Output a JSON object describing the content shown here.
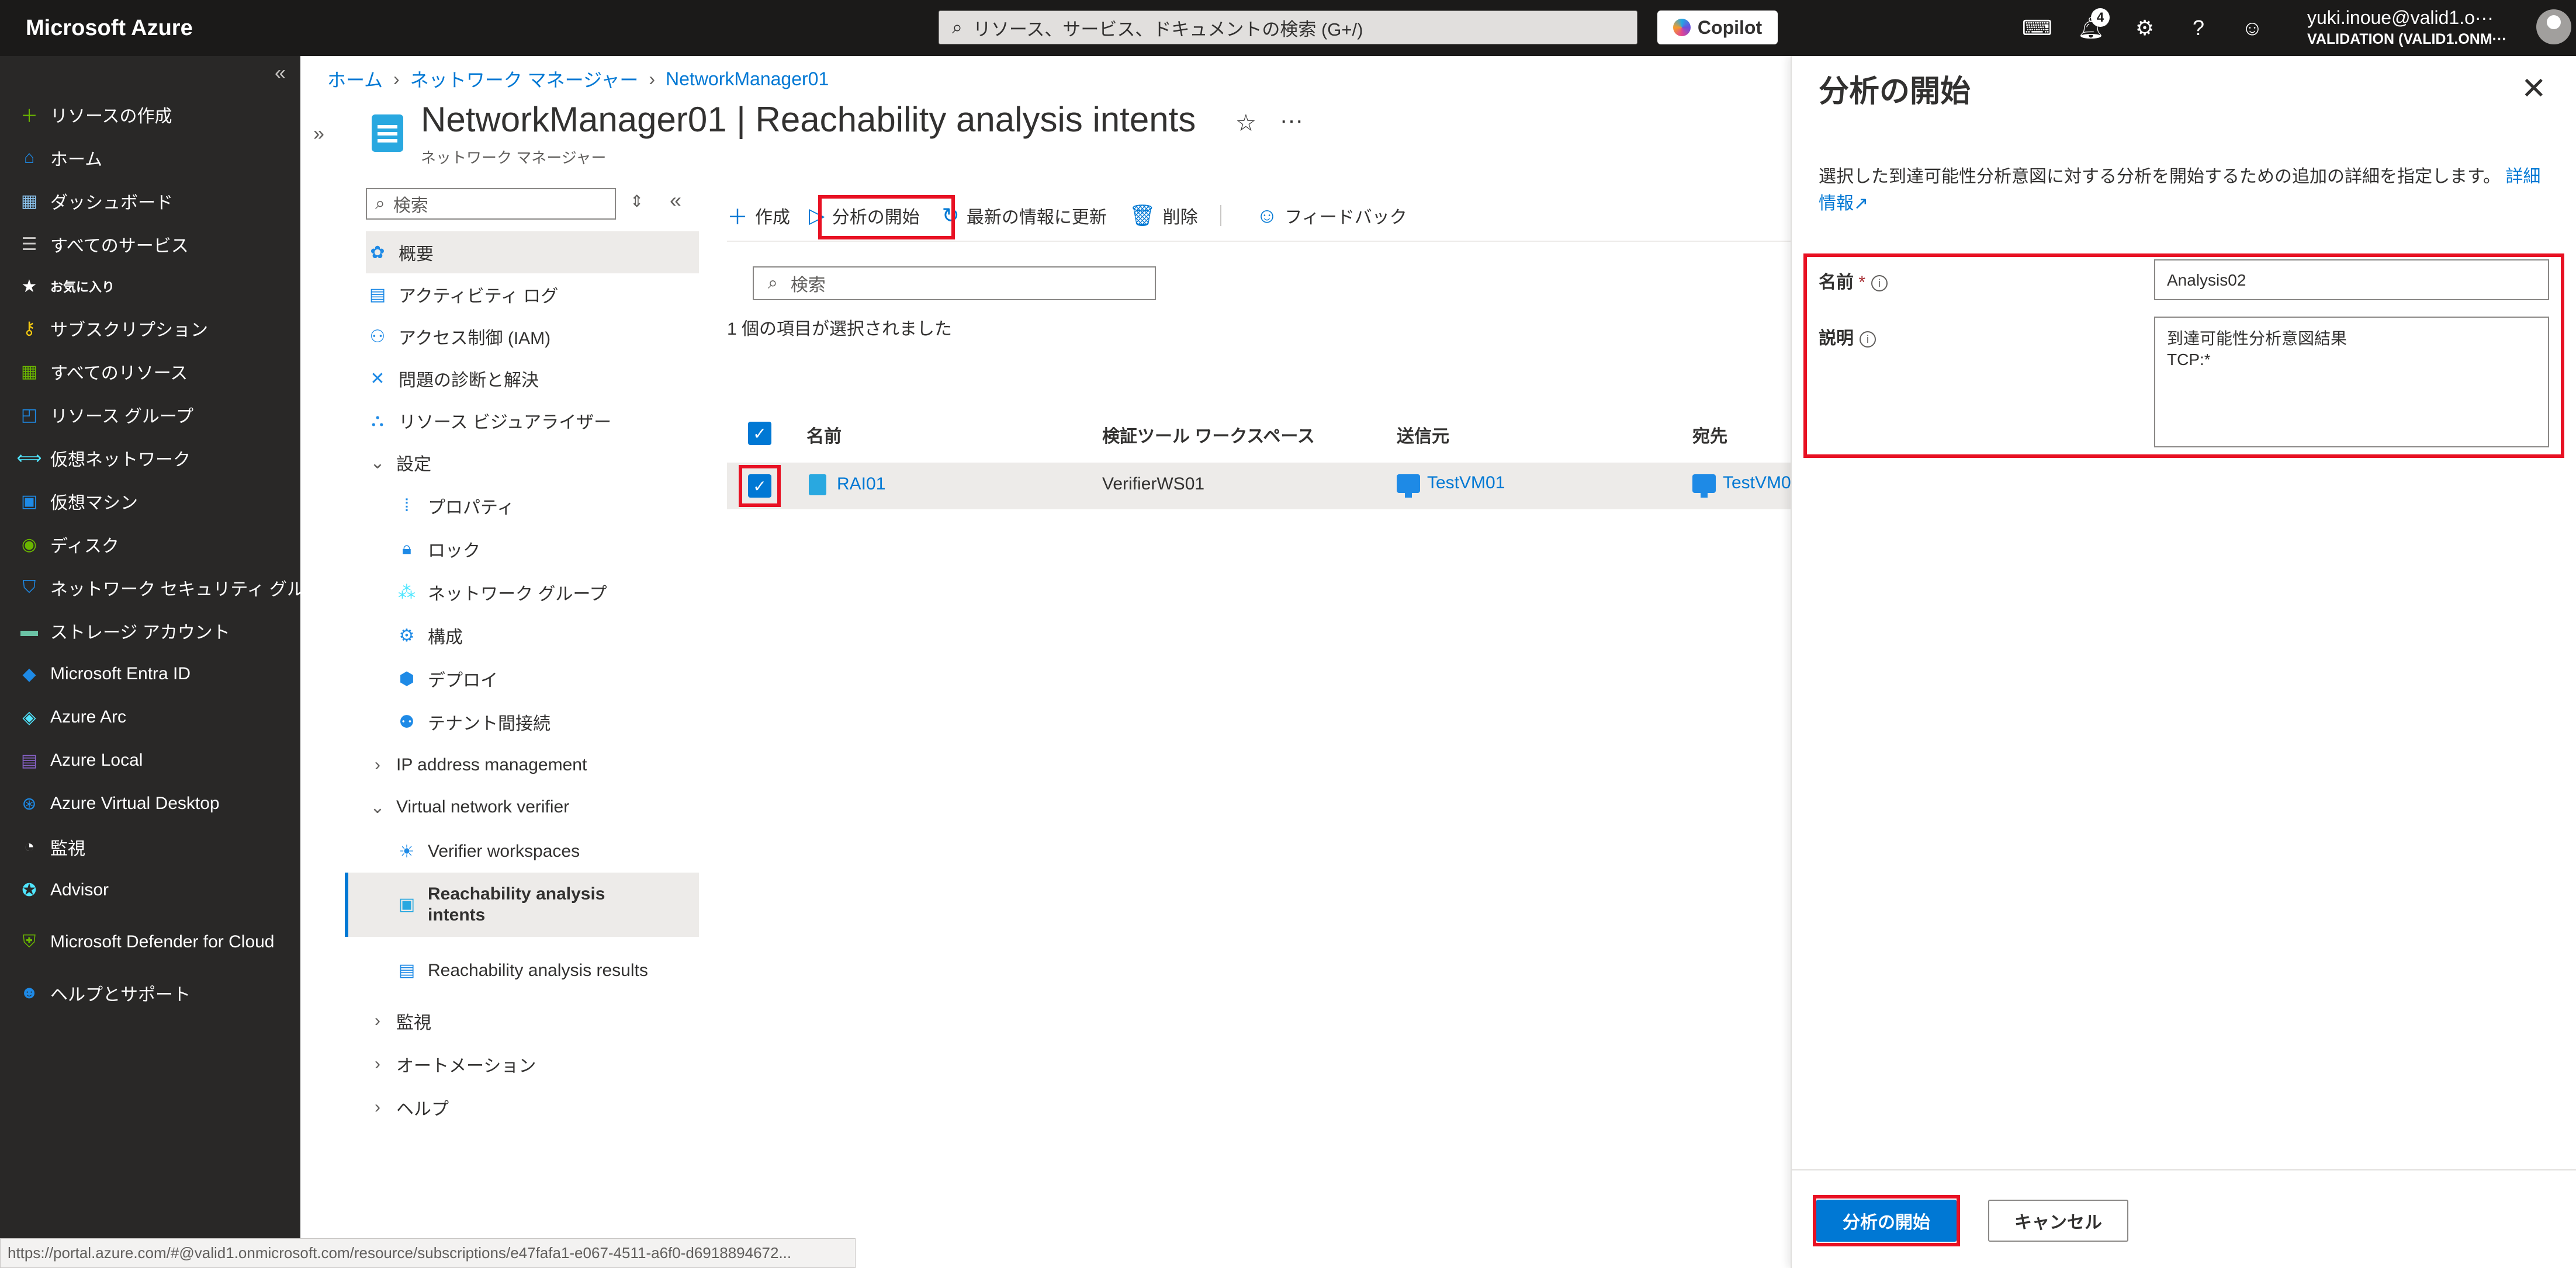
{
  "app": {
    "brand": "Microsoft Azure"
  },
  "topbar": {
    "search_placeholder": "リソース、サービス、ドキュメントの検索 (G+/)",
    "copilot_label": "Copilot",
    "notifications_count": "4",
    "user": "yuki.inoue@valid1.o···",
    "tenant": "VALIDATION (VALID1.ONM···"
  },
  "leftnav": {
    "items": [
      {
        "label": "リソースの作成",
        "icon": "plus-icon"
      },
      {
        "label": "ホーム",
        "icon": "home-icon"
      },
      {
        "label": "ダッシュボード",
        "icon": "dashboard-icon"
      },
      {
        "label": "すべてのサービス",
        "icon": "list-icon"
      },
      {
        "label": "お気に入り",
        "icon": "star-icon"
      },
      {
        "label": "サブスクリプション",
        "icon": "key-icon"
      },
      {
        "label": "すべてのリソース",
        "icon": "grid-icon"
      },
      {
        "label": "リソース グループ",
        "icon": "resource-group-icon"
      },
      {
        "label": "仮想ネットワーク",
        "icon": "vnet-icon"
      },
      {
        "label": "仮想マシン",
        "icon": "vm-icon"
      },
      {
        "label": "ディスク",
        "icon": "disk-icon"
      },
      {
        "label": "ネットワーク セキュリティ グループ",
        "icon": "shield-icon"
      },
      {
        "label": "ストレージ アカウント",
        "icon": "storage-icon"
      },
      {
        "label": "Microsoft Entra ID",
        "icon": "entra-icon"
      },
      {
        "label": "Azure Arc",
        "icon": "arc-icon"
      },
      {
        "label": "Azure Local",
        "icon": "local-icon"
      },
      {
        "label": "Azure Virtual Desktop",
        "icon": "desktop-icon"
      },
      {
        "label": "監視",
        "icon": "monitor-icon"
      },
      {
        "label": "Advisor",
        "icon": "advisor-icon"
      },
      {
        "label": "Microsoft Defender for Cloud",
        "icon": "defender-icon"
      },
      {
        "label": "ヘルプとサポート",
        "icon": "help-icon"
      }
    ]
  },
  "breadcrumb": [
    "ホーム",
    "ネットワーク マネージャー",
    "NetworkManager01"
  ],
  "resource": {
    "title": "NetworkManager01 | Reachability analysis intents",
    "subtitle": "ネットワーク マネージャー",
    "search_placeholder": "検索"
  },
  "menu": {
    "items": [
      "概要",
      "アクティビティ ログ",
      "アクセス制御 (IAM)",
      "問題の診断と解決",
      "リソース ビジュアライザー",
      "設定",
      "プロパティ",
      "ロック",
      "ネットワーク グループ",
      "構成",
      "デプロイ",
      "テナント間接続",
      "IP address management",
      "Virtual network verifier",
      "Verifier workspaces",
      "Reachability analysis intents",
      "Reachability analysis results",
      "監視",
      "オートメーション",
      "ヘルプ"
    ]
  },
  "commands": {
    "create": "作成",
    "start": "分析の開始",
    "refresh": "最新の情報に更新",
    "delete": "削除",
    "feedback": "フィードバック"
  },
  "grid": {
    "search_placeholder": "検索",
    "selection_text": "1 個の項目が選択されました",
    "headers": [
      "名前",
      "検証ツール ワークスペース",
      "送信元",
      "宛先"
    ],
    "rows": [
      {
        "name": "RAI01",
        "workspace": "VerifierWS01",
        "source": "TestVM01",
        "dest": "TestVM0"
      }
    ]
  },
  "panel": {
    "title": "分析の開始",
    "description": "選択した到達可能性分析意図に対する分析を開始するための追加の詳細を指定します。",
    "link": "詳細情報",
    "name_label": "名前",
    "required_mark": "*",
    "name_value": "Analysis02",
    "desc_label": "説明",
    "desc_value": "到達可能性分析意図結果\nTCP:*",
    "start_button": "分析の開始",
    "cancel_button": "キャンセル"
  },
  "status_url": "https://portal.azure.com/#@valid1.onmicrosoft.com/resource/subscriptions/e47fafa1-e067-4511-a6f0-d6918894672..."
}
